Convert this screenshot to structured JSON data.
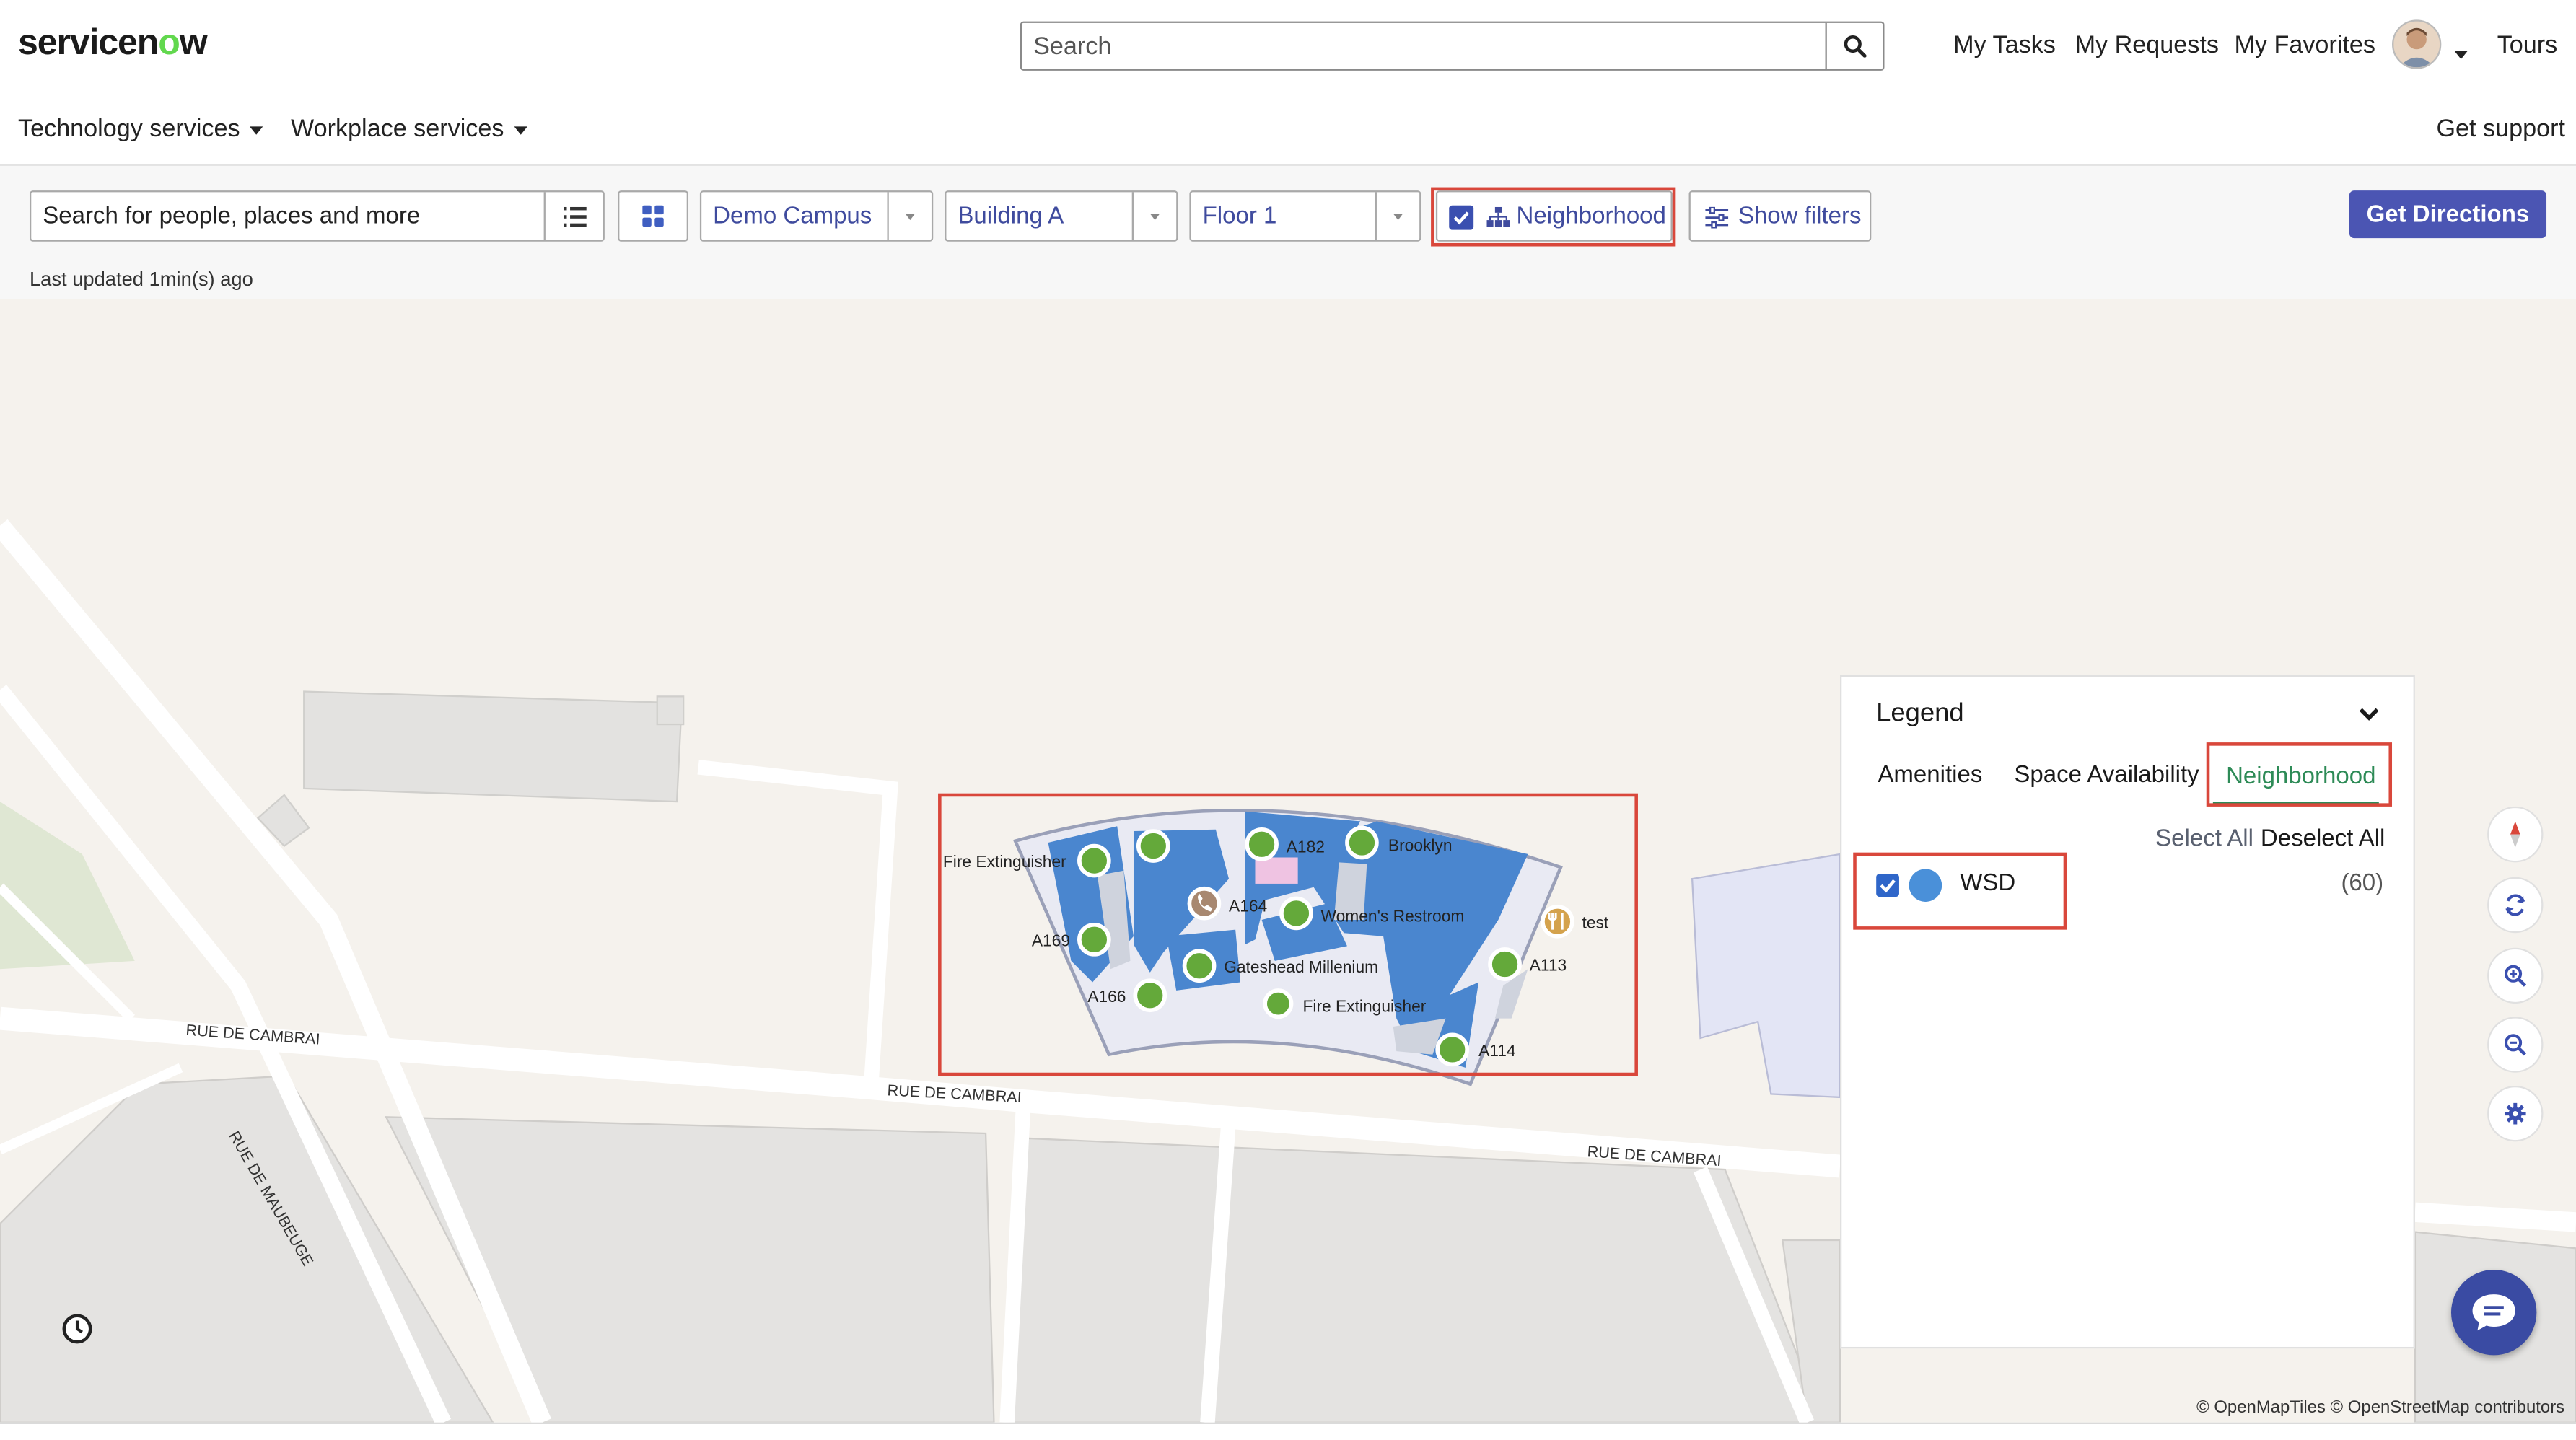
{
  "header": {
    "logo_prefix": "servicen",
    "logo_o": "o",
    "logo_suffix": "w",
    "search_placeholder": "Search",
    "nav": [
      "My Tasks",
      "My Requests",
      "My Favorites"
    ],
    "tours": "Tours"
  },
  "secondary_nav": {
    "technology": "Technology services",
    "workplace": "Workplace services",
    "support": "Get support"
  },
  "toolbar": {
    "search_placeholder": "Search for people, places and more",
    "campus": "Demo Campus",
    "building": "Building A",
    "floor": "Floor 1",
    "neighborhood": "Neighborhood",
    "neighborhood_checked": true,
    "show_filters": "Show filters",
    "get_directions": "Get Directions",
    "last_updated": "Last updated 1min(s) ago"
  },
  "map": {
    "streets": [
      "RUE DE CAMBRAI",
      "RUE DE CAMBRAI",
      "RUE DE CAMBRAI",
      "RUE DE MAUBEUGE"
    ],
    "labels": {
      "fire_ext_1": "Fire Extinguisher",
      "a182": "A182",
      "brooklyn": "Brooklyn",
      "a164": "A164",
      "womens": "Women's Restroom",
      "test": "test",
      "a169": "A169",
      "gateshead": "Gateshead Millenium",
      "a113": "A113",
      "a166": "A166",
      "fire_ext_2": "Fire Extinguisher",
      "a114": "A114"
    },
    "attribution": "© OpenMapTiles © OpenStreetMap contributors"
  },
  "legend": {
    "title": "Legend",
    "tabs": [
      "Amenities",
      "Space Availability",
      "Neighborhood"
    ],
    "active_tab": "Neighborhood",
    "select_all": "Select All",
    "deselect_all": "Deselect All",
    "items": [
      {
        "name": "WSD",
        "count": "(60)",
        "color": "#4a90d9",
        "checked": true
      }
    ]
  },
  "colors": {
    "accent": "#3f4b9e",
    "primary_button": "#4b55b3",
    "highlight": "#d9473b",
    "room_blue": "#4a86cf",
    "marker_green": "#64a93a",
    "active_tab_text": "#2e8b57"
  }
}
